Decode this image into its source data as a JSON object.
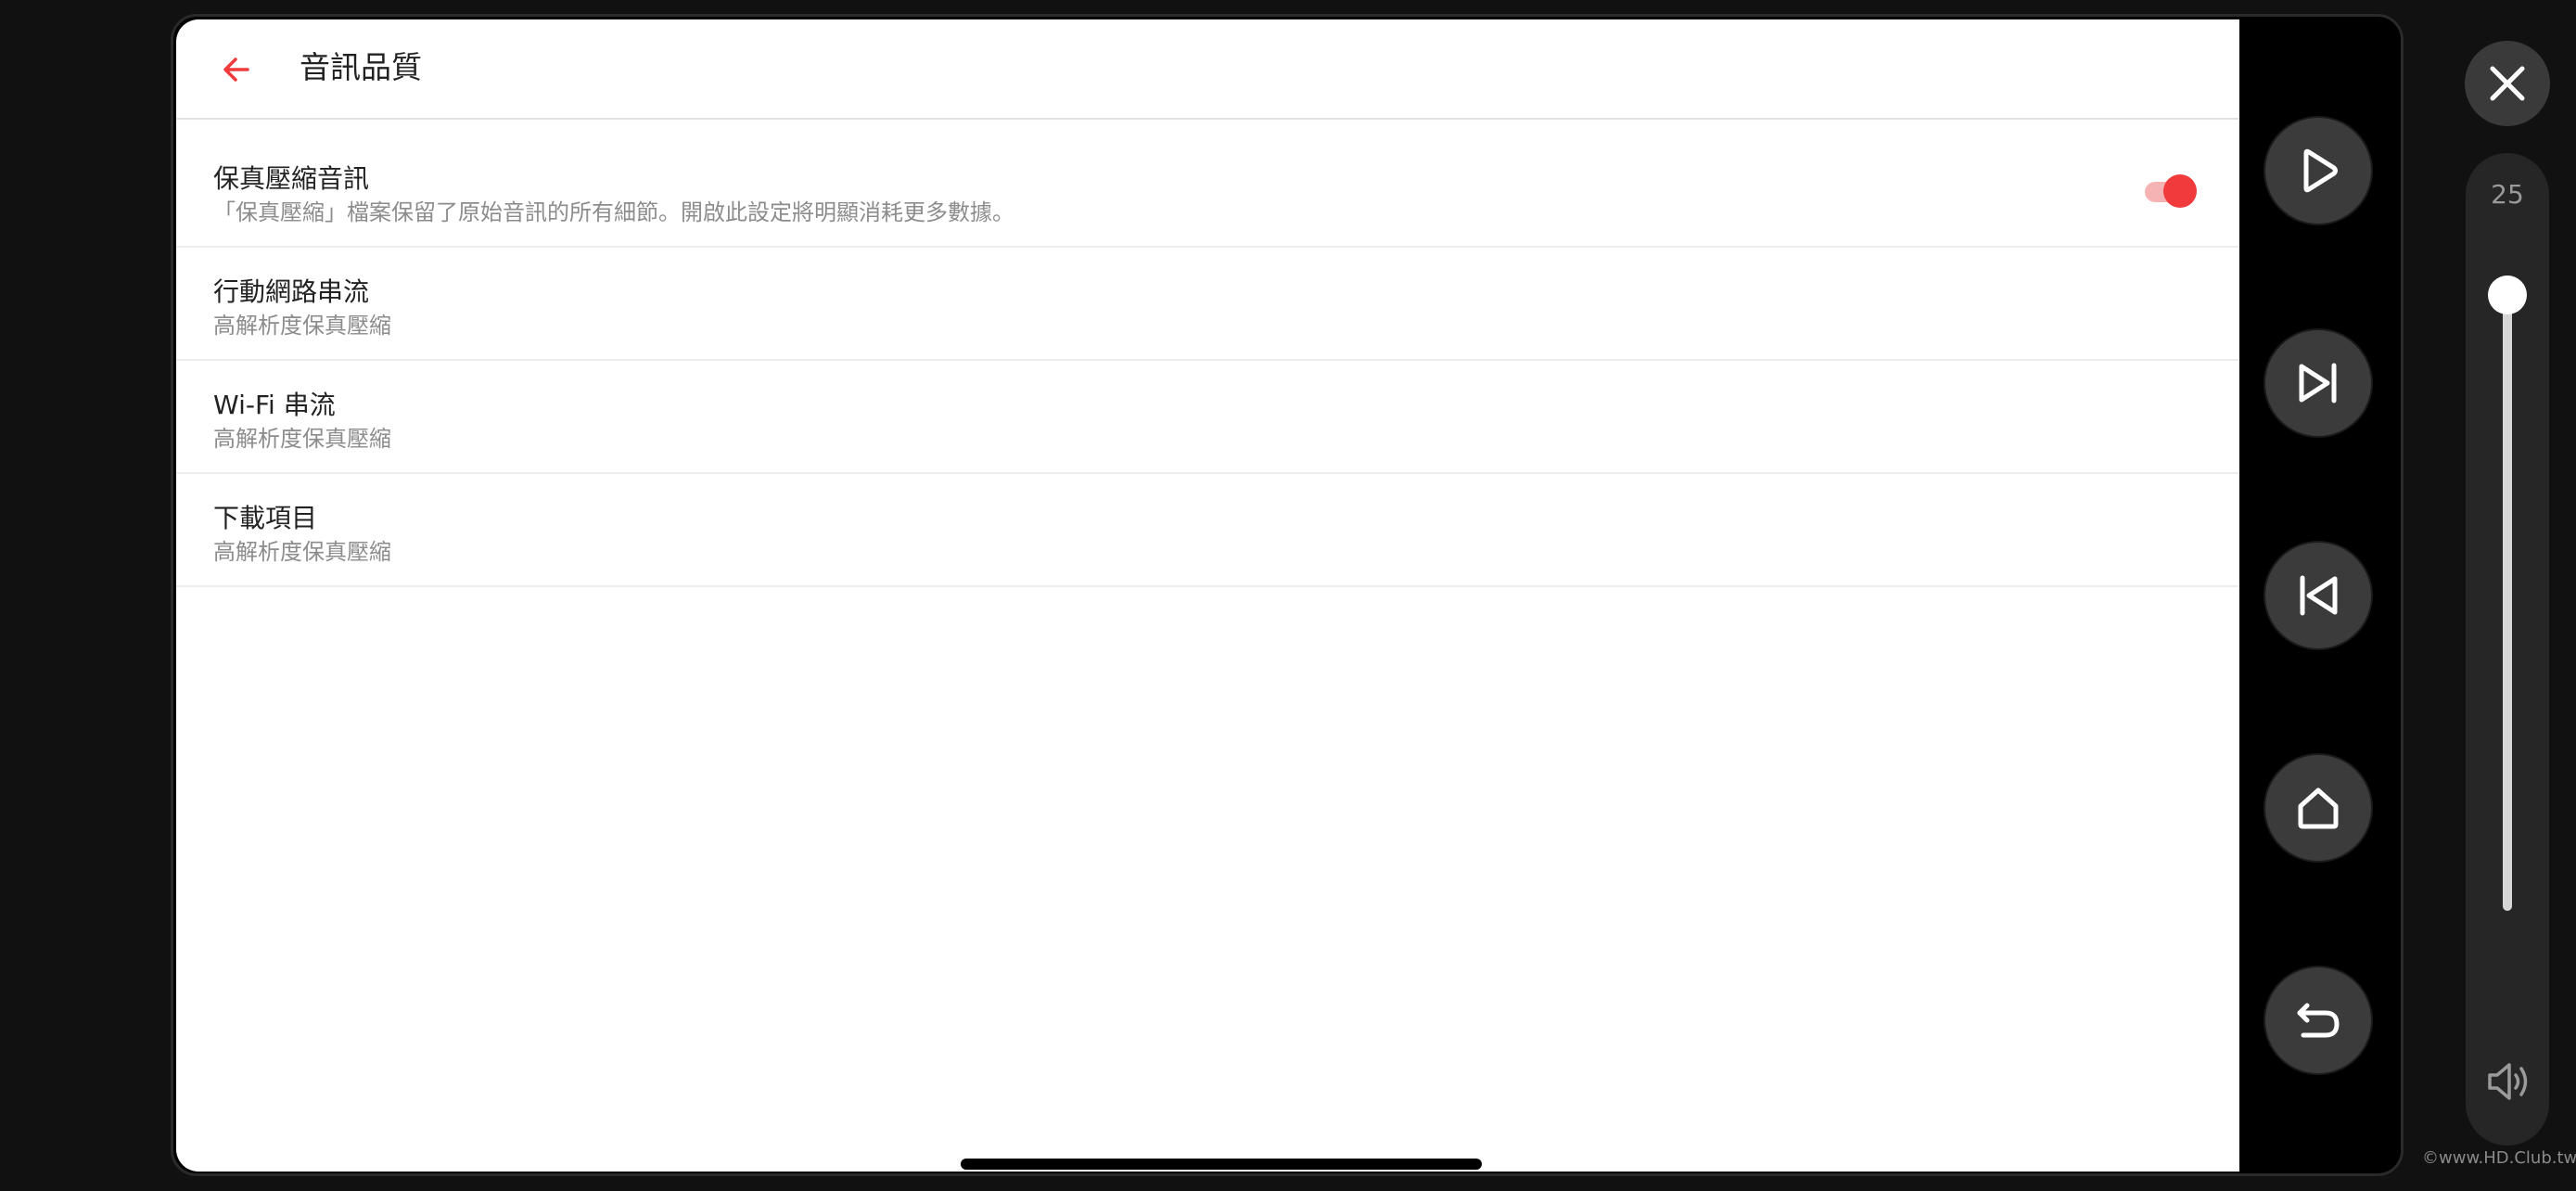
{
  "header": {
    "title": "音訊品質",
    "back_icon": "arrow-left-icon"
  },
  "settings": [
    {
      "title": "保真壓縮音訊",
      "subtitle": "「保真壓縮」檔案保留了原始音訊的所有細節。開啟此設定將明顯消耗更多數據。",
      "toggle_on": true
    },
    {
      "title": "行動網路串流",
      "subtitle": "高解析度保真壓縮"
    },
    {
      "title": "Wi-Fi 串流",
      "subtitle": "高解析度保真壓縮"
    },
    {
      "title": "下載項目",
      "subtitle": "高解析度保真壓縮"
    }
  ],
  "controls": {
    "icons": [
      "play-icon",
      "skip-forward-icon",
      "skip-back-icon",
      "home-icon",
      "return-icon"
    ]
  },
  "volume": {
    "level": "25",
    "icon": "speaker-icon"
  },
  "close_icon": "close-icon",
  "watermark": "©www.HD.Club.tw",
  "colors": {
    "accent": "#f03a3c",
    "toggle_track": "#f6b3b3",
    "control_button": "#3b3b3b",
    "background": "#111111"
  }
}
